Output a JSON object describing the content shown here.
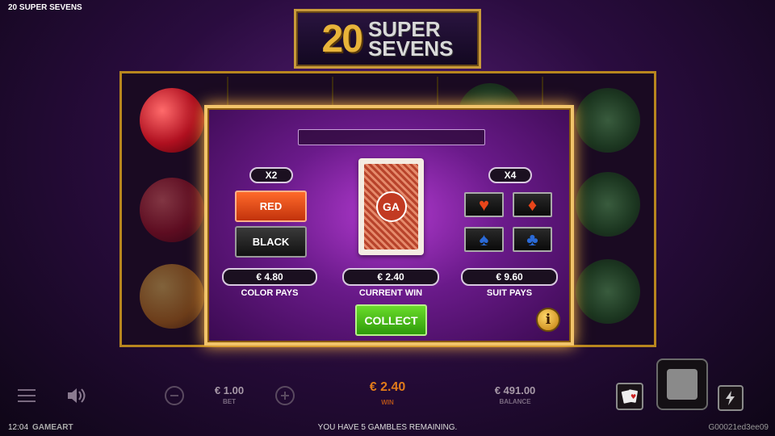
{
  "game_title": "20 SUPER SEVENS",
  "logo": {
    "number": "20",
    "word1": "SUPER",
    "word2": "SEVENS"
  },
  "gamble": {
    "color_multiplier": "X2",
    "red_label": "RED",
    "black_label": "BLACK",
    "card_logo": "GA",
    "suit_multiplier": "X4",
    "color_pays_value": "€ 4.80",
    "color_pays_label": "COLOR PAYS",
    "current_win_value": "€ 2.40",
    "current_win_label": "CURRENT WIN",
    "suit_pays_value": "€ 9.60",
    "suit_pays_label": "SUIT PAYS",
    "collect_label": "COLLECT",
    "info_label": "i",
    "suits": [
      {
        "symbol": "♥",
        "color": "#e8451a"
      },
      {
        "symbol": "♦",
        "color": "#e8451a"
      },
      {
        "symbol": "♠",
        "color": "#2a6ad8"
      },
      {
        "symbol": "♣",
        "color": "#2a6ad8"
      }
    ]
  },
  "bottom_bar": {
    "bet_value": "€ 1.00",
    "bet_label": "BET",
    "win_value": "€ 2.40",
    "win_label": "WIN",
    "balance_value": "€ 491.00",
    "balance_label": "BALANCE"
  },
  "footer": {
    "time": "12:04",
    "brand": "GAMEART",
    "message": "YOU HAVE 5 GAMBLES REMAINING.",
    "session_id": "G00021ed3ee09"
  },
  "colors": {
    "win": "#e07a1a",
    "accent_gold": "#f2c46a"
  }
}
